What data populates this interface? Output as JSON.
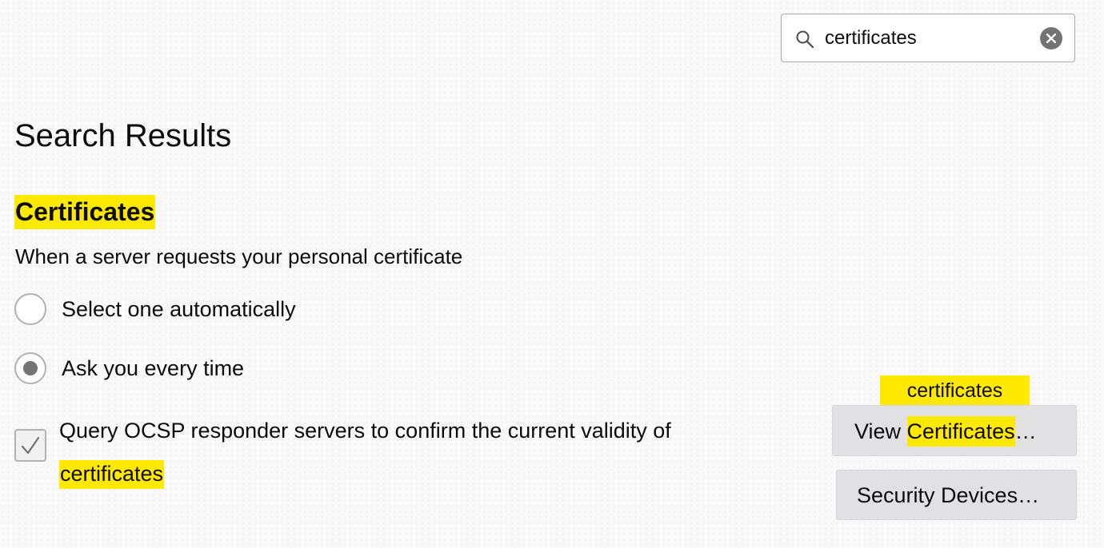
{
  "search": {
    "value": "certificates",
    "search_icon": "search-icon",
    "clear_icon": "close-circle-icon"
  },
  "page": {
    "title": "Search Results"
  },
  "section": {
    "title": "Certificates",
    "description": "When a server requests your personal certificate",
    "radios": [
      {
        "label": "Select one automatically",
        "checked": false
      },
      {
        "label": "Ask you every time",
        "checked": true
      }
    ],
    "ocsp": {
      "label": "Query OCSP responder servers to confirm the current validity of",
      "highlight": "certificates",
      "checked": true
    }
  },
  "tooltip": {
    "text": "certificates"
  },
  "buttons": {
    "view_prefix": "View ",
    "view_highlight": "Certificates",
    "view_suffix": "…",
    "security_devices": "Security Devices…"
  },
  "colors": {
    "highlight": "#ffe900",
    "background": "#f9f9fa",
    "button": "#e1e1e3",
    "radio_dot": "#737373"
  }
}
